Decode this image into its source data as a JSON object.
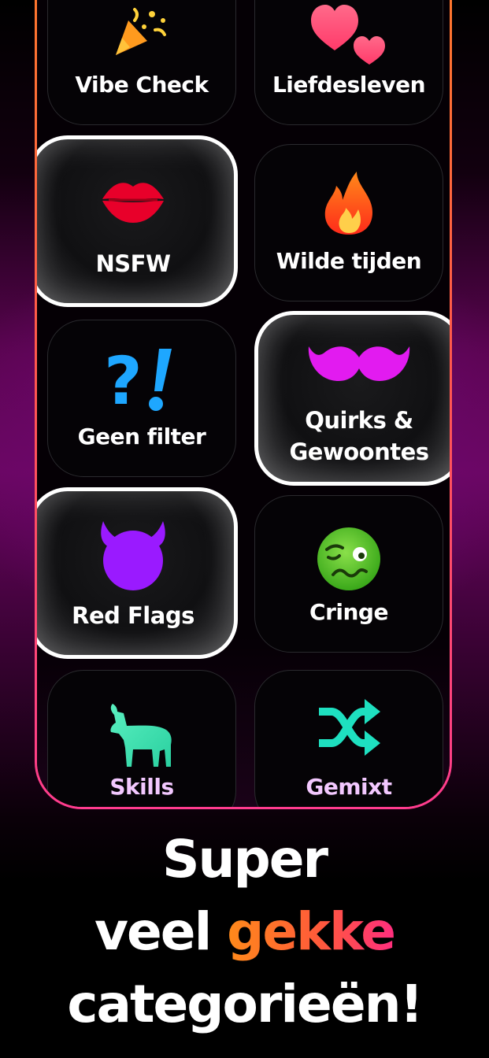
{
  "categories": [
    {
      "label": "Vibe Check",
      "icon": "party-popper-icon",
      "selected": false
    },
    {
      "label": "Liefdesleven",
      "icon": "two-hearts-icon",
      "selected": false
    },
    {
      "label": "NSFW",
      "icon": "kiss-lips-icon",
      "selected": true
    },
    {
      "label": "Wilde tijden",
      "icon": "fire-icon",
      "selected": false
    },
    {
      "label": "Geen filter",
      "icon": "question-exclamation-icon",
      "selected": false
    },
    {
      "label": "Quirks &",
      "label2": "Gewoontes",
      "icon": "mustache-icon",
      "selected": true
    },
    {
      "label": "Red Flags",
      "icon": "devil-face-icon",
      "selected": true
    },
    {
      "label": "Cringe",
      "icon": "woozy-face-icon",
      "selected": false
    },
    {
      "label": "Skills",
      "icon": "goat-icon",
      "selected": false
    },
    {
      "label": "Gemixt",
      "icon": "shuffle-icon",
      "selected": false
    }
  ],
  "headline": {
    "line1": "Super",
    "line2_a": "veel ",
    "line2_b": "gekke",
    "line3": "categorieën!"
  },
  "colors": {
    "accent_start": "#ff8a1a",
    "accent_end": "#ff2e7e",
    "frame_border": "#ff5a4a",
    "tile_border": "#2a2a2e",
    "selected_border": "#ffffff",
    "background_glow": "#6a0562"
  }
}
